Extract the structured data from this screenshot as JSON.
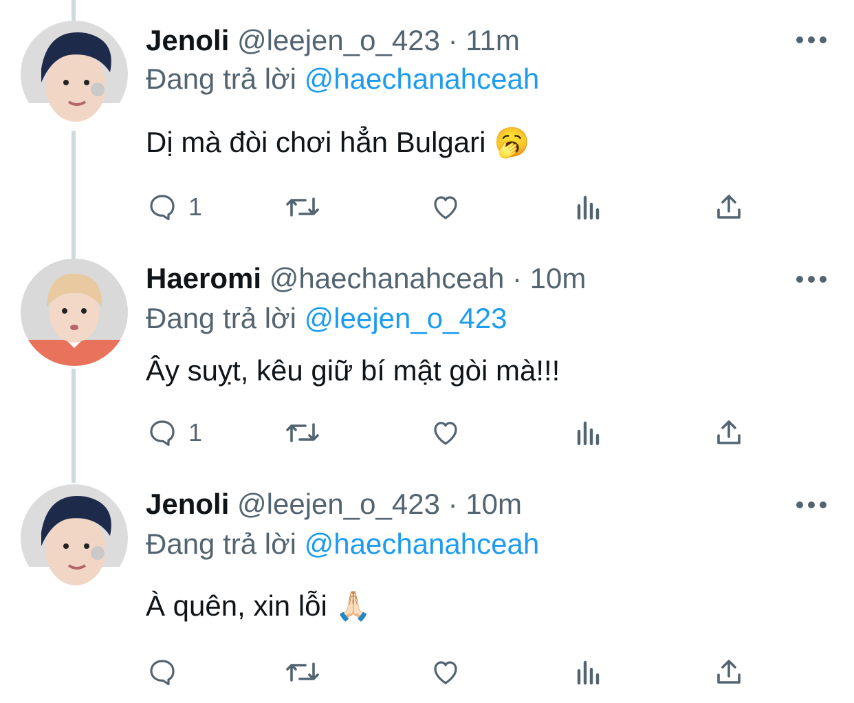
{
  "tweets": [
    {
      "name": "Jenoli",
      "handle": "@leejen_o_423",
      "separator": "·",
      "time": "11m",
      "replying_prefix": "Đang trả lời",
      "replying_to": "@haechanahceah",
      "text": "Dị mà đòi chơi hẳn Bulgari",
      "emoji": "🥱",
      "reply_count": "1",
      "avatar_colors": {
        "bg": "#dcdcdc",
        "hair": "#1e2a4a",
        "skin": "#f1d6c6",
        "shirt": "#ffffff"
      }
    },
    {
      "name": "Haeromi",
      "handle": "@haechanahceah",
      "separator": "·",
      "time": "10m",
      "replying_prefix": "Đang trả lời",
      "replying_to": "@leejen_o_423",
      "text": "Ây suỵt, kêu giữ bí mật gòi mà!!!",
      "emoji": "",
      "reply_count": "1",
      "avatar_colors": {
        "bg": "#d9d9d9",
        "hair": "#e8c9a0",
        "skin": "#f3d8c8",
        "shirt": "#e8735a"
      }
    },
    {
      "name": "Jenoli",
      "handle": "@leejen_o_423",
      "separator": "·",
      "time": "10m",
      "replying_prefix": "Đang trả lời",
      "replying_to": "@haechanahceah",
      "text": "À quên, xin lỗi",
      "emoji": "🙏🏻",
      "reply_count": "",
      "avatar_colors": {
        "bg": "#dcdcdc",
        "hair": "#1e2a4a",
        "skin": "#f1d6c6",
        "shirt": "#ffffff"
      }
    }
  ],
  "icons": {
    "reply": "reply-icon",
    "retweet": "retweet-icon",
    "like": "heart-icon",
    "views": "views-icon",
    "share": "share-icon",
    "more": "more-icon"
  },
  "colors": {
    "text": "#0f1419",
    "secondary": "#536471",
    "link": "#1d9bf0",
    "thread_line": "#cfd9de"
  }
}
